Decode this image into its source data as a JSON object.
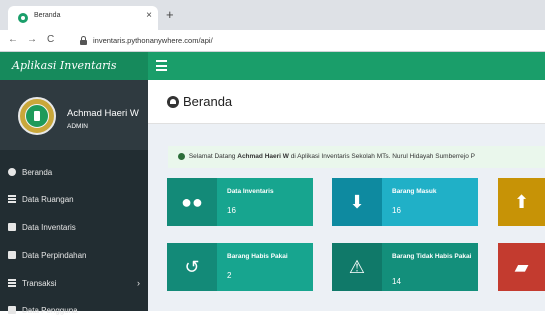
{
  "browser": {
    "tab_title": "Beranda",
    "tab_close": "×",
    "new_tab": "+",
    "back": "←",
    "forward": "→",
    "reload": "C",
    "url": "inventaris.pythonanywhere.com/api/"
  },
  "app": {
    "brand": "Aplikasi Inventaris",
    "accent": "#1a9e6a"
  },
  "user": {
    "name": "Achmad Haeri W",
    "role": "ADMIN"
  },
  "sidebar": {
    "items": [
      {
        "label": "Beranda",
        "icon": "dashboard-icon"
      },
      {
        "label": "Data Ruangan",
        "icon": "list-icon"
      },
      {
        "label": "Data Inventaris",
        "icon": "document-icon"
      },
      {
        "label": "Data Perpindahan",
        "icon": "document-icon"
      },
      {
        "label": "Transaksi",
        "icon": "list-icon",
        "chevron": "›"
      },
      {
        "label": "Data Pengguna",
        "icon": "users-icon"
      }
    ]
  },
  "page": {
    "title": "Beranda"
  },
  "welcome": {
    "prefix": "Selamat Datang",
    "name": "Achmad Haeri W",
    "suffix": "di Aplikasi Inventaris Sekolah MTs. Nurul Hidayah Sumberrejo P"
  },
  "cards": [
    {
      "label": "Data Inventaris",
      "value": "16",
      "icon": "users-icon",
      "color": "#17a58f"
    },
    {
      "label": "Barang Masuk",
      "value": "16",
      "icon": "download-icon",
      "color": "#20b0c7"
    },
    {
      "label": "",
      "value": "",
      "icon": "upload-icon",
      "color": "#f0b21d"
    },
    {
      "label": "Barang Habis Pakai",
      "value": "2",
      "icon": "history-icon",
      "color": "#17a58f"
    },
    {
      "label": "Barang Tidak Habis Pakai",
      "value": "14",
      "icon": "warning-icon",
      "color": "#138f7b"
    },
    {
      "label": "",
      "value": "",
      "icon": "folder-icon",
      "color": "#e2483a"
    }
  ]
}
